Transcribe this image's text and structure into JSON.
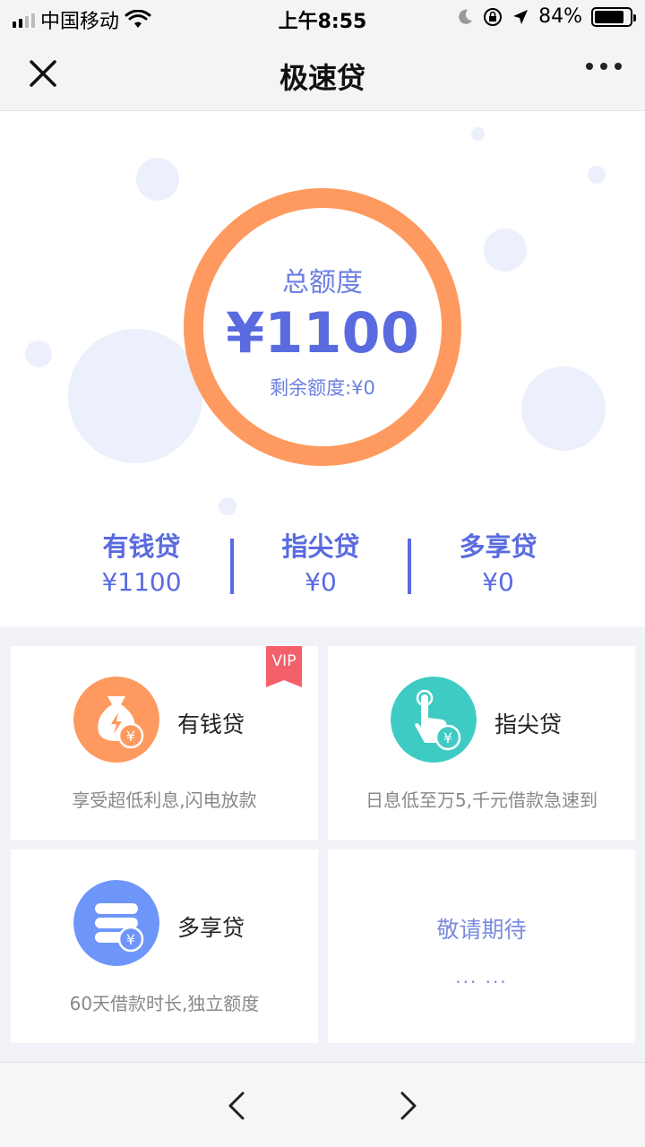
{
  "status_bar": {
    "carrier": "中国移动",
    "time": "上午8:55",
    "battery_percent": "84%",
    "battery_level": 0.84
  },
  "nav": {
    "title": "极速贷"
  },
  "hero": {
    "total_label": "总额度",
    "total_amount": "¥1100",
    "remaining": "剩余额度:¥0"
  },
  "summary": [
    {
      "name": "有钱贷",
      "value": "¥1100"
    },
    {
      "name": "指尖贷",
      "value": "¥0"
    },
    {
      "name": "多享贷",
      "value": "¥0"
    }
  ],
  "cards": [
    {
      "name": "有钱贷",
      "desc": "享受超低利息,闪电放款",
      "badge": "VIP",
      "icon": "money-bag-icon",
      "color": "#fe9a5f"
    },
    {
      "name": "指尖贷",
      "desc": "日息低至万5,千元借款急速到",
      "icon": "finger-tap-icon",
      "color": "#3ecbc4"
    },
    {
      "name": "多享贷",
      "desc": "60天借款时长,独立额度",
      "icon": "coin-stack-icon",
      "color": "#6e95f9"
    }
  ],
  "coming_soon": {
    "title": "敬请期待",
    "dots": "... ..."
  },
  "colors": {
    "accent": "#5a6be0",
    "ring": "#fe9a5f",
    "vip": "#f4606a"
  }
}
